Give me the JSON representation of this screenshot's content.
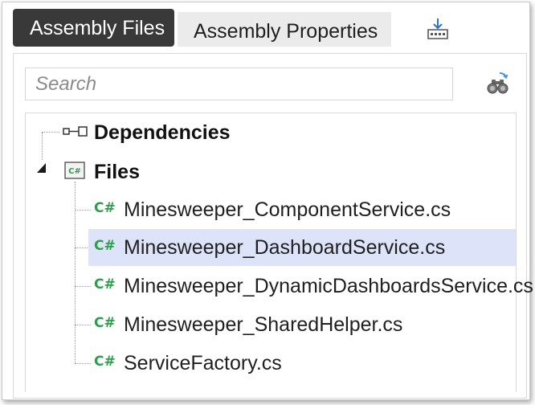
{
  "tabs": {
    "assembly_files": "Assembly Files",
    "assembly_properties": "Assembly Properties"
  },
  "icons": {
    "download": "download-icon",
    "binoculars": "binoculars-icon",
    "dependencies": "dependencies-icon",
    "csharp_folder": "csharp-folder-icon",
    "csharp_file": "csharp-file-icon"
  },
  "search": {
    "placeholder": "Search",
    "value": ""
  },
  "tree": {
    "dependencies": {
      "label": "Dependencies"
    },
    "files": {
      "label": "Files",
      "expanded": true,
      "items": [
        {
          "icon_text": "C#",
          "label": "Minesweeper_ComponentService.cs",
          "selected": false
        },
        {
          "icon_text": "C#",
          "label": "Minesweeper_DashboardService.cs",
          "selected": true
        },
        {
          "icon_text": "C#",
          "label": "Minesweeper_DynamicDashboardsService.cs",
          "selected": false
        },
        {
          "icon_text": "C#",
          "label": "Minesweeper_SharedHelper.cs",
          "selected": false
        },
        {
          "icon_text": "C#",
          "label": "ServiceFactory.cs",
          "selected": false
        }
      ]
    }
  },
  "colors": {
    "active_tab_bg": "#393939",
    "inactive_tab_bg": "#ebebeb",
    "selected_row_bg": "#dde3f8",
    "csharp_green": "#2e9e4b"
  }
}
